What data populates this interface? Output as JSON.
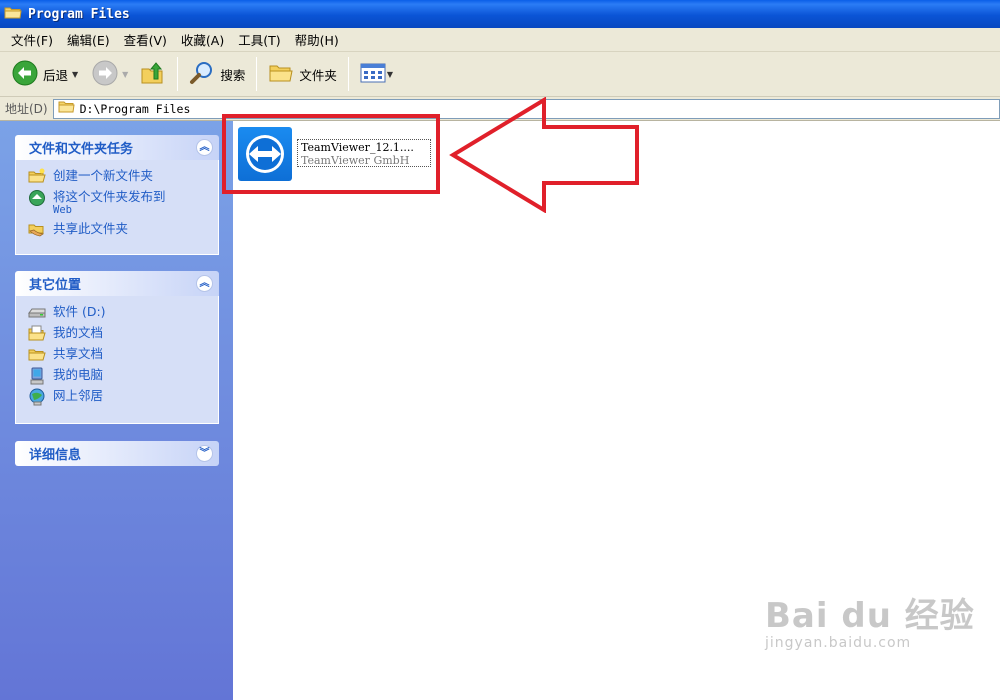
{
  "window": {
    "title": "Program Files"
  },
  "menu": [
    {
      "label": "文件(F)"
    },
    {
      "label": "编辑(E)"
    },
    {
      "label": "查看(V)"
    },
    {
      "label": "收藏(A)"
    },
    {
      "label": "工具(T)"
    },
    {
      "label": "帮助(H)"
    }
  ],
  "toolbar": {
    "back_label": "后退",
    "search_label": "搜索",
    "folders_label": "文件夹"
  },
  "address": {
    "label": "地址(D)",
    "path": "D:\\Program Files"
  },
  "left_pane": {
    "tasks_panel": {
      "title": "文件和文件夹任务",
      "items": [
        {
          "label": "创建一个新文件夹",
          "sub": "",
          "icon": "new-folder-icon"
        },
        {
          "label": "将这个文件夹发布到",
          "sub": "Web",
          "icon": "publish-web-icon"
        },
        {
          "label": "共享此文件夹",
          "sub": "",
          "icon": "share-folder-icon"
        }
      ]
    },
    "places_panel": {
      "title": "其它位置",
      "items": [
        {
          "label": "软件 (D:)",
          "icon": "drive-icon"
        },
        {
          "label": "我的文档",
          "icon": "my-documents-icon"
        },
        {
          "label": "共享文档",
          "icon": "shared-documents-icon"
        },
        {
          "label": "我的电脑",
          "icon": "my-computer-icon"
        },
        {
          "label": "网上邻居",
          "icon": "network-places-icon"
        }
      ]
    },
    "details_panel": {
      "title": "详细信息"
    }
  },
  "content": {
    "files": [
      {
        "name": "TeamViewer_12.1....",
        "company": "TeamViewer GmbH",
        "icon": "teamviewer-icon"
      }
    ]
  },
  "annotation": {
    "color": "#e0202a"
  },
  "watermark": {
    "logo": "Bai du 经验",
    "url": "jingyan.baidu.com"
  },
  "colors": {
    "title_bar": "#0a54d6",
    "link_blue": "#215dc6",
    "chrome": "#ece9d8"
  }
}
